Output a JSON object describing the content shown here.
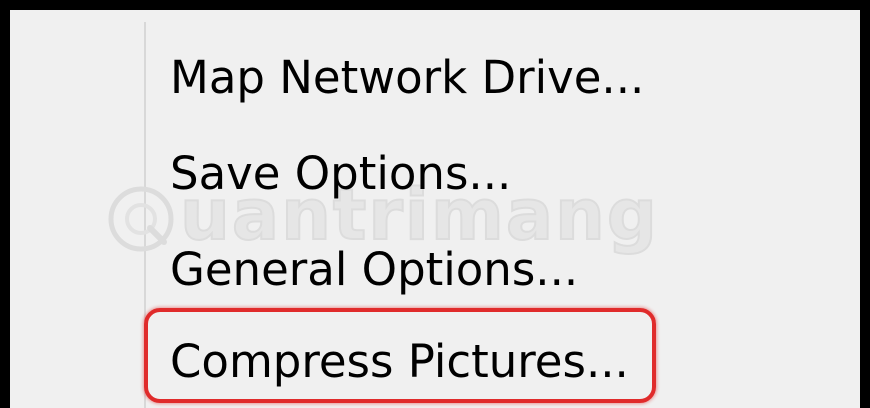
{
  "menu": {
    "items": [
      {
        "label": "Map Network Drive..."
      },
      {
        "label": "Save Options..."
      },
      {
        "label": "General Options..."
      },
      {
        "label": "Compress Pictures..."
      }
    ],
    "highlighted_index": 3
  },
  "watermark": {
    "text": "uantrimang"
  },
  "colors": {
    "highlight_border": "#e02b2b",
    "menu_background": "#f0f0f0",
    "frame_border": "#000000"
  }
}
